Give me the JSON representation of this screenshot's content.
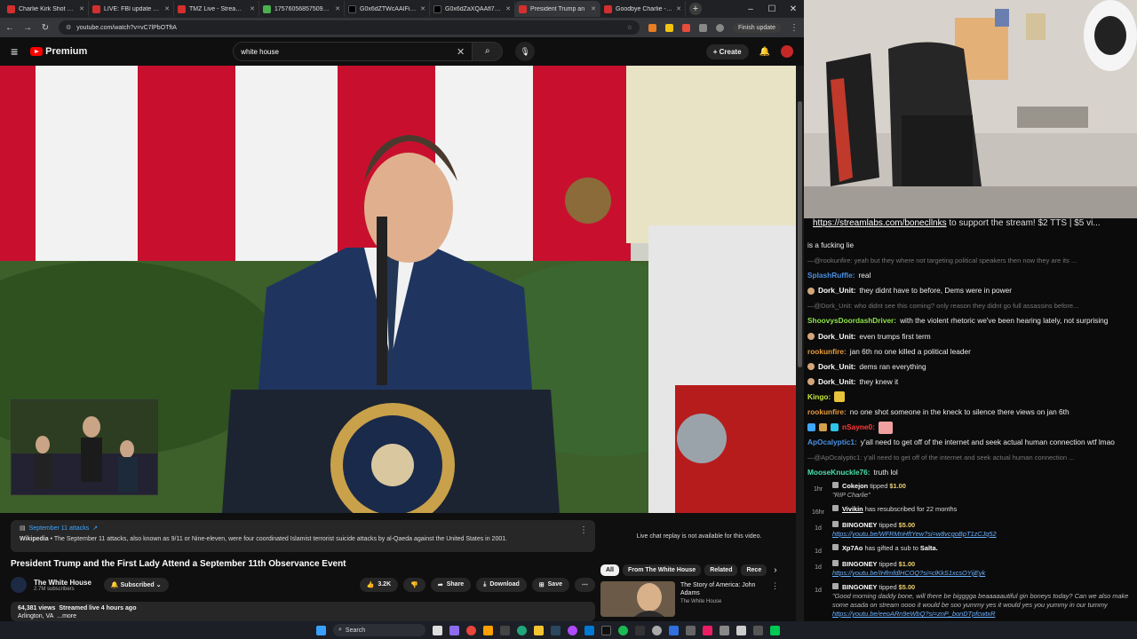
{
  "browser": {
    "tabs": [
      {
        "label": "Charlie Kirk Shot Dead",
        "color": "#d32f2f"
      },
      {
        "label": "LIVE: FBI update on Ch",
        "color": "#d32f2f"
      },
      {
        "label": "TMZ Live - Streaming",
        "color": "#d32f2f"
      },
      {
        "label": "1757605685750902.j",
        "color": "#4caf50"
      },
      {
        "label": "G0x6dZTWcAAIFiD (31",
        "color": "#000000"
      },
      {
        "label": "G0x6dZaXQAAfl7p (32",
        "color": "#000000"
      },
      {
        "label": "President Trump an",
        "color": "#d32f2f"
      },
      {
        "label": "Goodbye Charlie - You",
        "color": "#d32f2f"
      }
    ],
    "url": "youtube.com/watch?v=vC7lPbOTftA",
    "finish_update": "Finish update"
  },
  "youtube": {
    "logo": "Premium",
    "search_value": "white house",
    "create_label": "Create"
  },
  "wiki": {
    "title": "September 11 attacks",
    "source": "Wikipedia",
    "text": " • The September 11 attacks, also known as 9/11 or Nine-eleven, were four coordinated Islamist terrorist suicide attacks by al-Qaeda against the United States in 2001."
  },
  "video": {
    "title": "President Trump and the First Lady Attend a September 11th Observance Event",
    "channel": "The White House",
    "subscribers": "2.7M subscribers",
    "subscribed_label": "Subscribed",
    "likes": "3.2K",
    "share": "Share",
    "download": "Download",
    "save": "Save",
    "views": "64,381 views",
    "streamed": "Streamed live 4 hours ago",
    "location": "Arlington, VA",
    "more": "...more"
  },
  "sidebar": {
    "chat_replay": "Live chat replay is not available for this video.",
    "chips": [
      "All",
      "From The White House",
      "Related",
      "Rece"
    ],
    "related": {
      "title": "The Story of America: John Adams",
      "channel": "The White House"
    }
  },
  "stream": {
    "banner_link": "https://streamlabs.com/bonecllnks",
    "banner_text": " to support the stream! $2 TTS | $5 vi...",
    "messages": [
      {
        "name": "",
        "text": "is a fucking lie",
        "color": "#ffffff",
        "reply": false,
        "badge": false
      },
      {
        "name": "",
        "text": "—@rookunfire: yeah but they where not targeting political speakers then now they are its ...",
        "color": "#777777",
        "reply": true,
        "badge": false
      },
      {
        "name": "SplashRuffle:",
        "text": "real",
        "color": "#4a90e2",
        "reply": false,
        "badge": false
      },
      {
        "name": "Dork_Unit:",
        "text": "they didnt have to before, Dems were in power",
        "color": "#ffffff",
        "reply": false,
        "badge": true
      },
      {
        "name": "",
        "text": "—@Dork_Unit: who didnt see this coming? only reason they didnt go full assassins before...",
        "color": "#777777",
        "reply": true,
        "badge": false
      },
      {
        "name": "ShoovysDoordashDriver:",
        "text": "with the violent rhetoric we've been hearing lately, not surprising",
        "color": "#8ee34a",
        "reply": false,
        "badge": false
      },
      {
        "name": "Dork_Unit:",
        "text": "even trumps first term",
        "color": "#ffffff",
        "reply": false,
        "badge": true
      },
      {
        "name": "rookunfire:",
        "text": "jan 6th no one killed a political leader",
        "color": "#e59a3c",
        "reply": false,
        "badge": false
      },
      {
        "name": "Dork_Unit:",
        "text": "dems ran everything",
        "color": "#ffffff",
        "reply": false,
        "badge": true
      },
      {
        "name": "Dork_Unit:",
        "text": "they knew it",
        "color": "#ffffff",
        "reply": false,
        "badge": true
      },
      {
        "name": "Kingo:",
        "text": "",
        "color": "#c5e83a",
        "reply": false,
        "badge": false,
        "emote": "#e8c23a"
      },
      {
        "name": "rookunfire:",
        "text": "no one shot someone in the kneck to silence there views on jan 6th",
        "color": "#e59a3c",
        "reply": false,
        "badge": false
      },
      {
        "name": "nSayne0:",
        "text": "",
        "color": "#ff3b3b",
        "reply": false,
        "badge": false,
        "emote": "#f0a0a0"
      },
      {
        "name": "ApOcalyptic1:",
        "text": "y'all need to get off of the internet and seek actual human connection wtf lmao",
        "color": "#4a90e2",
        "reply": false,
        "badge": false
      },
      {
        "name": "",
        "text": "—@ApOcalyptic1: y'all need to get off of the internet and seek actual human connection ...",
        "color": "#777777",
        "reply": true,
        "badge": false
      },
      {
        "name": "MooseKnuckle76:",
        "text": "truth lol",
        "color": "#4ae0a8",
        "reply": false,
        "badge": false
      }
    ],
    "events": [
      {
        "time": "1hr",
        "user": "Cokejon",
        "action": " tipped ",
        "amount": "$1.00",
        "msg": "\"RIP Charlie\"",
        "link": ""
      },
      {
        "time": "16hr",
        "user": "Vivikin",
        "action": " has resubscribed for 22 months",
        "amount": "",
        "msg": "",
        "link": ""
      },
      {
        "time": "1d",
        "user": "BINGONEY",
        "action": " tipped ",
        "amount": "$5.00",
        "msg": "",
        "link": "https://youtu.be/WFRMnHftYew?si=w8vcgoBpT1zCJq52"
      },
      {
        "time": "1d",
        "user": "Xp7Ao",
        "action": " has gifted a sub to ",
        "amount": "Salta.",
        "msg": "",
        "link": ""
      },
      {
        "time": "1d",
        "user": "BINGONEY",
        "action": " tipped ",
        "amount": "$1.00",
        "msg": "",
        "link": "https://youtu.be/IHfmfdlHCOQ?si=clKkS1xcsOYijEyk"
      },
      {
        "time": "1d",
        "user": "BINGONEY",
        "action": " tipped ",
        "amount": "$5.00",
        "msg": "\"Good morning daddy bone, will there be bigggga beaaaaautiful gin boneys today? Can we also make some asada on stream oooo it would be soo yummy yes it would yes you yummy in our tummy",
        "link": "https://youtu.be/eeoARn9eWbQ?si=znP_bonDTpfcwtxR"
      }
    ]
  },
  "taskbar": {
    "search": "Search"
  }
}
